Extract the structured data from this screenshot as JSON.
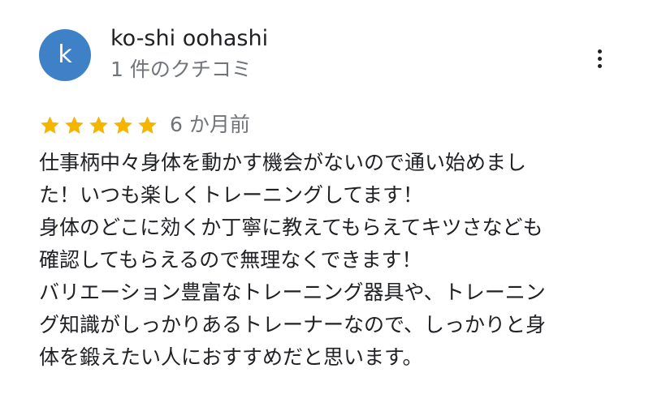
{
  "author": {
    "initial": "k",
    "name": "ko-shi oohashi",
    "review_count": "1 件のクチコミ",
    "avatar_color": "#3f81c6"
  },
  "menu": {
    "icon": "more-vert-icon"
  },
  "rating": {
    "stars": 5,
    "max_stars": 5,
    "star_color": "#f4b400",
    "date": "6 か月前"
  },
  "review": {
    "lines": [
      "仕事柄中々身体を動かす機会がないので通い始めまし",
      "た！いつも楽しくトレーニングしてます！",
      "身体のどこに効くか丁寧に教えてもらえてキツさなども",
      "確認してもらえるので無理なくできます！",
      "バリエーション豊富なトレーニング器具や、トレーニン",
      "グ知識がしっかりあるトレーナーなので、しっかりと身",
      "体を鍛えたい人におすすめだと思います。"
    ]
  }
}
